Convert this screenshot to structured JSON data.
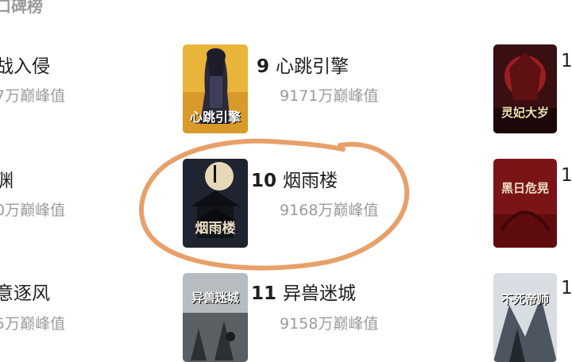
{
  "ranking": {
    "section_title": "口碑榜",
    "left_column": [
      {
        "title": "战入侵",
        "meta": "7万巅峰值"
      },
      {
        "title": "渊",
        "meta": "0万巅峰值"
      },
      {
        "title": "意逐风",
        "meta": "5万巅峰值"
      }
    ],
    "middle_column": [
      {
        "rank": "9",
        "title": "心跳引擎",
        "meta": "9171万巅峰值",
        "cover_text": "心跳引擎"
      },
      {
        "rank": "10",
        "title": "烟雨楼",
        "meta": "9168万巅峰值",
        "cover_text": "烟雨楼"
      },
      {
        "rank": "11",
        "title": "异兽迷城",
        "meta": "9158万巅峰值",
        "cover_text": "异兽迷城"
      }
    ],
    "right_column": [
      {
        "rank_partial": "1",
        "cover_text": "灵妃大岁"
      },
      {
        "rank_partial": "1",
        "cover_text": "黑日危晃"
      },
      {
        "rank_partial": "1",
        "cover_text": "不死帝师"
      }
    ]
  },
  "colors": {
    "highlight_circle": "#e8a06a",
    "meta_text": "#9b9b9b",
    "title_text": "#1e1e1e"
  }
}
